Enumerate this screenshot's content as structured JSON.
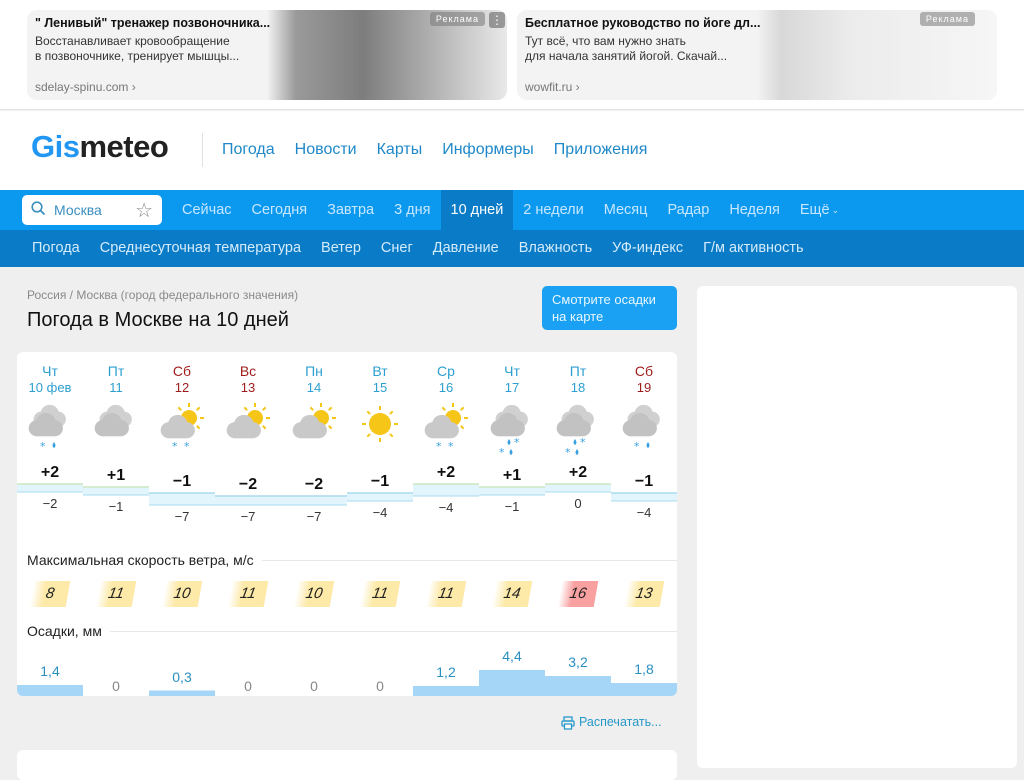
{
  "ads": [
    {
      "title": "\" Ленивый\" тренажер позвоночника...",
      "description": "Восстанавливает кровообращение\nв позвоночнике, тренирует мышцы...",
      "domain": "sdelay-spinu.com",
      "label": "Реклама",
      "menu": "⋮"
    },
    {
      "title": "Бесплатное руководство по йоге дл...",
      "description": "Тут всё, что вам нужно знать\nдля начала занятий йогой. Скачай...",
      "domain": "wowfit.ru",
      "label": "Реклама"
    }
  ],
  "header": {
    "logo_a": "Gis",
    "logo_b": "meteo",
    "nav": [
      "Погода",
      "Новости",
      "Карты",
      "Информеры",
      "Приложения"
    ]
  },
  "search": {
    "value": "Москва"
  },
  "nav_periods": [
    "Сейчас",
    "Сегодня",
    "Завтра",
    "3 дня",
    "10 дней",
    "2 недели",
    "Месяц",
    "Радар",
    "Неделя",
    "Ещё"
  ],
  "nav_active": "10 дней",
  "nav_params": [
    "Погода",
    "Среднесуточная температура",
    "Ветер",
    "Снег",
    "Давление",
    "Влажность",
    "УФ-индекс",
    "Г/м активность"
  ],
  "breadcrumb": "Россия / Москва (город федерального значения)",
  "title": "Погода в Москве на 10 дней",
  "map_button": "Смотрите осадки на карте",
  "forecast": {
    "days": [
      {
        "name": "Чт",
        "date": "10 фев",
        "weekend": false,
        "icon": "cloudy-snow-rain",
        "tmax": "+2",
        "tmin": "−2",
        "wind": "8",
        "precip": "1,4"
      },
      {
        "name": "Пт",
        "date": "11",
        "weekend": false,
        "icon": "cloudy",
        "tmax": "+1",
        "tmin": "−1",
        "wind": "11",
        "precip": "0"
      },
      {
        "name": "Сб",
        "date": "12",
        "weekend": true,
        "icon": "partly-cloudy-snow",
        "tmax": "−1",
        "tmin": "−7",
        "wind": "10",
        "precip": "0,3"
      },
      {
        "name": "Вс",
        "date": "13",
        "weekend": true,
        "icon": "partly-cloudy",
        "tmax": "−2",
        "tmin": "−7",
        "wind": "11",
        "precip": "0"
      },
      {
        "name": "Пн",
        "date": "14",
        "weekend": false,
        "icon": "partly-cloudy",
        "tmax": "−2",
        "tmin": "−7",
        "wind": "10",
        "precip": "0"
      },
      {
        "name": "Вт",
        "date": "15",
        "weekend": false,
        "icon": "sunny",
        "tmax": "−1",
        "tmin": "−4",
        "wind": "11",
        "precip": "0"
      },
      {
        "name": "Ср",
        "date": "16",
        "weekend": false,
        "icon": "partly-cloudy-snow",
        "tmax": "+2",
        "tmin": "−4",
        "wind": "11",
        "precip": "1,2"
      },
      {
        "name": "Чт",
        "date": "17",
        "weekend": false,
        "icon": "cloudy-heavy-snow-rain",
        "tmax": "+1",
        "tmin": "−1",
        "wind": "14",
        "precip": "4,4"
      },
      {
        "name": "Пт",
        "date": "18",
        "weekend": false,
        "icon": "cloudy-heavy-snow-rain",
        "tmax": "+2",
        "tmin": "0",
        "wind": "16",
        "precip": "3,2"
      },
      {
        "name": "Сб",
        "date": "19",
        "weekend": true,
        "icon": "cloudy-snow-rain",
        "tmax": "−1",
        "tmin": "−4",
        "wind": "13",
        "precip": "1,8"
      }
    ],
    "tmax_values": [
      2,
      1,
      -1,
      -2,
      -2,
      -1,
      2,
      1,
      2,
      -1
    ],
    "tmin_values": [
      -2,
      -1,
      -7,
      -7,
      -7,
      -4,
      -4,
      -1,
      0,
      -4
    ],
    "precip_values": [
      1.4,
      0,
      0.3,
      0,
      0,
      0,
      1.2,
      4.4,
      3.2,
      1.8
    ],
    "wind_label": "Максимальная скорость ветра, м/с",
    "precip_label": "Осадки, мм",
    "colors": {
      "wind_normal": "#fde9a8",
      "wind_high": "#f9a1a1",
      "precip": "#a5d6f7",
      "temp_warm": "#eaf6e4",
      "temp_cold": "#dff2fb"
    }
  },
  "print_label": "Распечатать..."
}
